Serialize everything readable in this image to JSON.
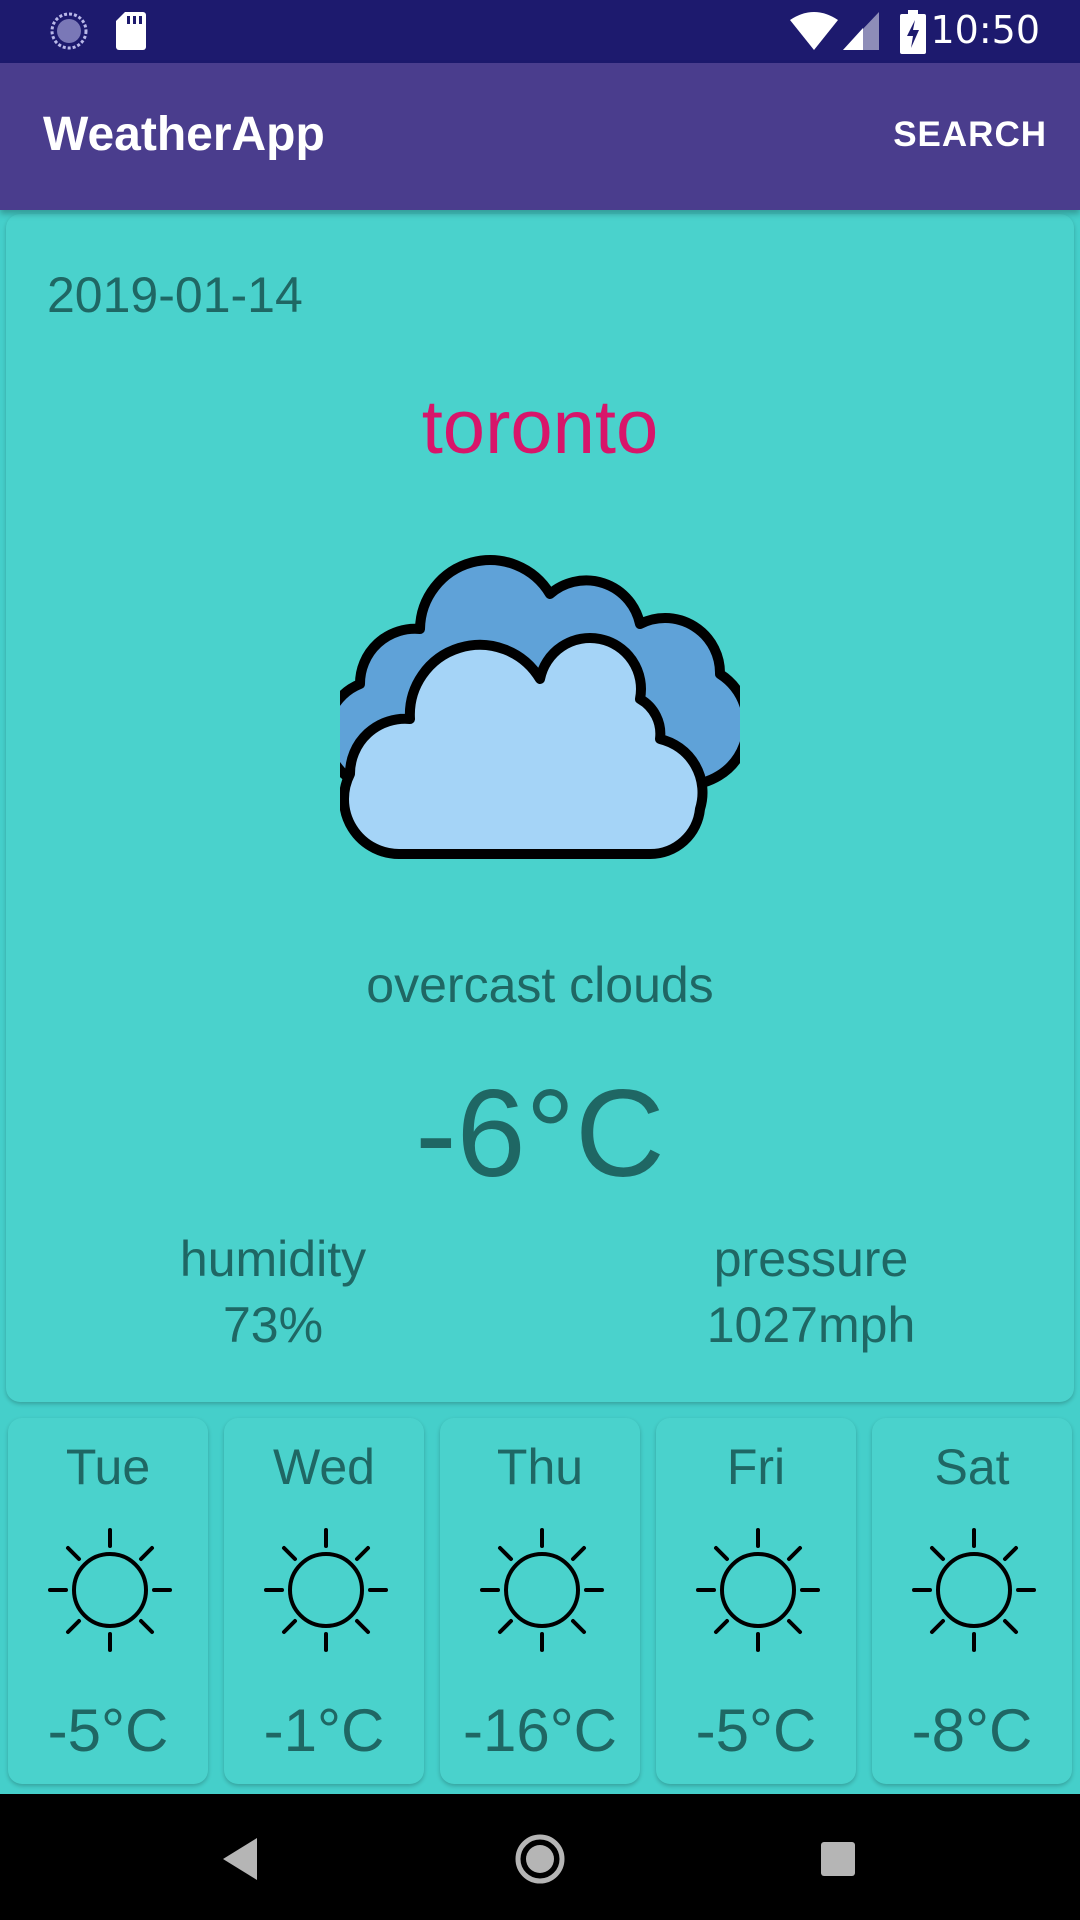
{
  "status_bar": {
    "time": "10:50",
    "left_icons": [
      "sync-icon",
      "sd-card-icon"
    ],
    "right_icons": [
      "wifi-icon",
      "signal-icon",
      "battery-charging-icon"
    ]
  },
  "app_bar": {
    "title": "WeatherApp",
    "search_label": "SEARCH",
    "color": "#4A3D8D"
  },
  "current": {
    "date": "2019-01-14",
    "city": "toronto",
    "icon": "overcast-clouds-icon",
    "description": "overcast clouds",
    "temperature": "-6°C",
    "humidity_label": "humidity",
    "humidity_value": "73%",
    "pressure_label": "pressure",
    "pressure_value": "1027mph"
  },
  "forecast": [
    {
      "day": "Tue",
      "icon": "sun-icon",
      "temp": "-5°C"
    },
    {
      "day": "Wed",
      "icon": "sun-icon",
      "temp": "-1°C"
    },
    {
      "day": "Thu",
      "icon": "sun-icon",
      "temp": "-16°C"
    },
    {
      "day": "Fri",
      "icon": "sun-icon",
      "temp": "-5°C"
    },
    {
      "day": "Sat",
      "icon": "sun-icon",
      "temp": "-8°C"
    }
  ],
  "nav_bar": {
    "buttons": [
      "back-icon",
      "home-icon",
      "recents-icon"
    ]
  },
  "colors": {
    "background": "#45CFCA",
    "card": "#4AD2CC",
    "text": "#1F6764",
    "city": "#D8156A",
    "status_bar": "#1D1A6E"
  }
}
